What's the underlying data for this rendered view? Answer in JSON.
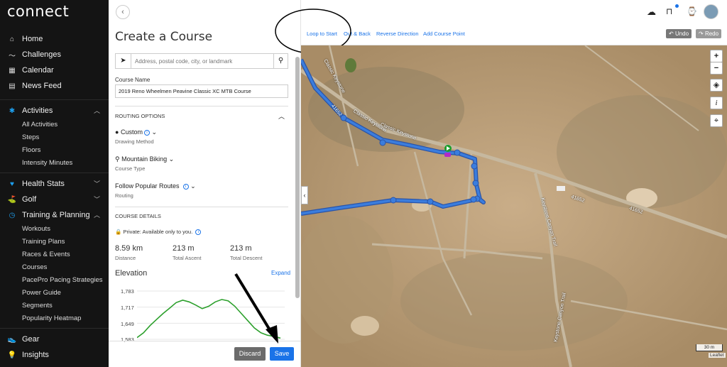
{
  "sidebar": {
    "logo": "connect",
    "items": [
      {
        "label": "Home",
        "icon": "home-icon"
      },
      {
        "label": "Challenges",
        "icon": "challenges-icon"
      },
      {
        "label": "Calendar",
        "icon": "calendar-icon"
      },
      {
        "label": "News Feed",
        "icon": "news-feed-icon"
      }
    ],
    "activities": {
      "label": "Activities",
      "icon": "activities-icon",
      "subitems": [
        "All Activities",
        "Steps",
        "Floors",
        "Intensity Minutes"
      ]
    },
    "health_stats": {
      "label": "Health Stats",
      "icon": "heart-icon"
    },
    "golf": {
      "label": "Golf",
      "icon": "golf-icon"
    },
    "training": {
      "label": "Training & Planning",
      "icon": "stopwatch-icon",
      "subitems": [
        "Workouts",
        "Training Plans",
        "Races & Events",
        "Courses",
        "PacePro Pacing Strategies",
        "Power Guide",
        "Segments",
        "Popularity Heatmap"
      ]
    },
    "gear": {
      "label": "Gear",
      "icon": "gear-shoe-icon"
    },
    "insights": {
      "label": "Insights",
      "icon": "lightbulb-icon"
    }
  },
  "panel": {
    "title": "Create a Course",
    "search_placeholder": "Address, postal code, city, or landmark",
    "course_name_label": "Course Name",
    "course_name_value": "2019 Reno Wheelmen Peavine Classic XC MTB Course",
    "routing_options_label": "ROUTING OPTIONS",
    "drawing_method": {
      "value": "Custom",
      "label": "Drawing Method"
    },
    "course_type": {
      "value": "Mountain Biking",
      "label": "Course Type"
    },
    "routing": {
      "value": "Follow Popular Routes",
      "label": "Routing"
    },
    "course_details_label": "COURSE DETAILS",
    "privacy": "Private: Available only to you.",
    "stats": [
      {
        "value": "8.59 km",
        "label": "Distance"
      },
      {
        "value": "213 m",
        "label": "Total Ascent"
      },
      {
        "value": "213 m",
        "label": "Total Descent"
      }
    ],
    "elevation_label": "Elevation",
    "expand_label": "Expand",
    "discard_label": "Discard",
    "save_label": "Save"
  },
  "toolbar": {
    "loop_to_start": "Loop to Start",
    "out_and_back": "Out & Back",
    "reverse_direction": "Reverse Direction",
    "add_course_point": "Add Course Point",
    "undo": "Undo",
    "redo": "Redo"
  },
  "map": {
    "zoom_in": "+",
    "zoom_out": "−",
    "info": "i",
    "scale": "30 m",
    "attribution": "Leaflet",
    "road_labels": [
      "Classic Keystone",
      "41652",
      "41652",
      "41652",
      "Keystone Canyon Trail",
      "Keystone Canyon Trail",
      "Classic Keystone"
    ]
  },
  "chart_data": {
    "type": "line",
    "title": "Elevation",
    "yticks": [
      "1,783",
      "1,717",
      "1,649",
      "1,583"
    ],
    "ylim": [
      1583,
      1783
    ],
    "series": [
      {
        "values": [
          1590,
          1610,
          1640,
          1665,
          1690,
          1712,
          1735,
          1745,
          1738,
          1725,
          1710,
          1720,
          1738,
          1748,
          1742,
          1720,
          1690,
          1660,
          1630,
          1610,
          1600,
          1595,
          1588
        ]
      }
    ],
    "colors": {
      "line": "#2ca02c"
    }
  },
  "colors": {
    "accent": "#1a73e8",
    "route": "#2f6fd8",
    "sidebar": "#141414"
  }
}
